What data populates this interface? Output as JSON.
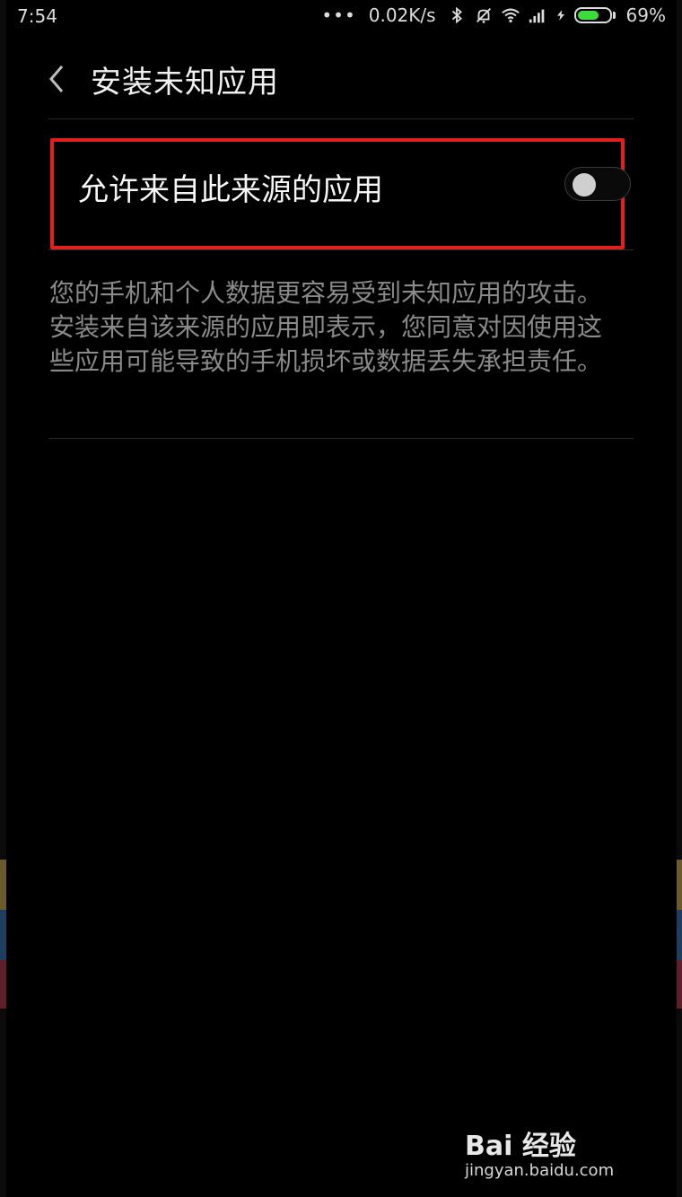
{
  "status_bar": {
    "time": "7:54",
    "dots": "•••",
    "net_speed": "0.02K/s",
    "battery_percent": "69%",
    "battery_level": 0.69,
    "icons": [
      "bluetooth-icon",
      "mute-icon",
      "wifi-icon",
      "signal-icon",
      "charging-icon",
      "battery-icon"
    ]
  },
  "header": {
    "title": "安装未知应用"
  },
  "setting": {
    "label": "允许来自此来源的应用",
    "enabled": false
  },
  "description": "您的手机和个人数据更容易受到未知应用的攻击。安装来自该来源的应用即表示，您同意对因使用这些应用可能导致的手机损坏或数据丢失承担责任。",
  "watermark": {
    "logo_text": "Bai 经验",
    "url": "jingyan.baidu.com"
  },
  "colors": {
    "highlight": "#e0201c",
    "battery": "#3ddc3d"
  }
}
